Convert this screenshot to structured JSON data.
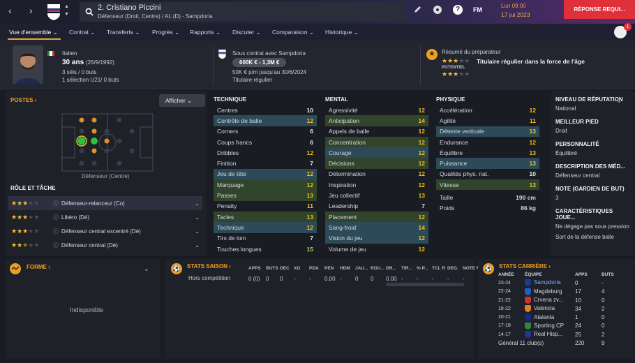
{
  "topbar": {
    "player_name": "2. Cristiano Piccini",
    "subtitle": "Défenseur (Droit, Centre) / AL (D) - Sampdoria",
    "fm_label": "FM",
    "date_line1": "Lun 09:00",
    "date_line2": "17 jui 2023",
    "action_button": "RÉPONSE REQUI...",
    "notification_count": "1"
  },
  "tabs": [
    "Vue d'ensemble",
    "Contrat",
    "Transferts",
    "Progrès",
    "Rapports",
    "Discuter",
    "Comparaison",
    "Historique"
  ],
  "header": {
    "nationality": "Italien",
    "age": "30 ans",
    "birth": "(26/9/1992)",
    "caps": "3 séls / 0 buts",
    "u21": "1 sélection U21/ 0 buts",
    "contract_label": "Sous contrat avec Sampdoria",
    "value_range": "600K € - 1,3M €",
    "wage": "50K € p/m jusqu'au 30/6/2024",
    "status": "Titulaire régulier",
    "coach_label": "Résumé du préparateur",
    "coach_summary": "Titulaire régulier dans la force de l'âge",
    "potential_label": "POTENTIEL"
  },
  "positions": {
    "title": "POSTES",
    "show_button": "Afficher",
    "position_label": "Défenseur (Centre)"
  },
  "roles": {
    "title": "RÔLE ET TÂCHE",
    "items": [
      {
        "label": "Défenseur-relanceur (Co)",
        "stars": 3
      },
      {
        "label": "Libéro (Dé)",
        "stars": 3
      },
      {
        "label": "Défenseur central excentré (Dé)",
        "stars": 3
      },
      {
        "label": "Défenseur central (Dé)",
        "stars": 2.5
      }
    ]
  },
  "technique": {
    "title": "TECHNIQUE",
    "rows": [
      {
        "name": "Centres",
        "value": "10",
        "hl": ""
      },
      {
        "name": "Contrôle de balle",
        "value": "12",
        "hl": "b"
      },
      {
        "name": "Corners",
        "value": "6",
        "hl": ""
      },
      {
        "name": "Coups francs",
        "value": "6",
        "hl": ""
      },
      {
        "name": "Dribbles",
        "value": "12",
        "hl": ""
      },
      {
        "name": "Finition",
        "value": "7",
        "hl": ""
      },
      {
        "name": "Jeu de tête",
        "value": "12",
        "hl": "b"
      },
      {
        "name": "Marquage",
        "value": "12",
        "hl": "g"
      },
      {
        "name": "Passes",
        "value": "13",
        "hl": "g"
      },
      {
        "name": "Penalty",
        "value": "11",
        "hl": ""
      },
      {
        "name": "Tacles",
        "value": "13",
        "hl": "g"
      },
      {
        "name": "Technique",
        "value": "12",
        "hl": "b"
      },
      {
        "name": "Tirs de loin",
        "value": "7",
        "hl": ""
      },
      {
        "name": "Touches longues",
        "value": "15",
        "hl": ""
      }
    ]
  },
  "mental": {
    "title": "MENTAL",
    "rows": [
      {
        "name": "Agressivité",
        "value": "12",
        "hl": ""
      },
      {
        "name": "Anticipation",
        "value": "14",
        "hl": "g"
      },
      {
        "name": "Appels de balle",
        "value": "12",
        "hl": ""
      },
      {
        "name": "Concentration",
        "value": "12",
        "hl": "g"
      },
      {
        "name": "Courage",
        "value": "12",
        "hl": "b"
      },
      {
        "name": "Décisions",
        "value": "12",
        "hl": "g"
      },
      {
        "name": "Détermination",
        "value": "12",
        "hl": ""
      },
      {
        "name": "Inspiration",
        "value": "12",
        "hl": ""
      },
      {
        "name": "Jeu collectif",
        "value": "13",
        "hl": ""
      },
      {
        "name": "Leadership",
        "value": "7",
        "hl": ""
      },
      {
        "name": "Placement",
        "value": "12",
        "hl": "g"
      },
      {
        "name": "Sang-froid",
        "value": "14",
        "hl": "b"
      },
      {
        "name": "Vision du jeu",
        "value": "12",
        "hl": "b"
      },
      {
        "name": "Volume de jeu",
        "value": "12",
        "hl": ""
      }
    ]
  },
  "physique": {
    "title": "PHYSIQUE",
    "rows": [
      {
        "name": "Accélération",
        "value": "12",
        "hl": ""
      },
      {
        "name": "Agilité",
        "value": "11",
        "hl": ""
      },
      {
        "name": "Détente verticale",
        "value": "13",
        "hl": "b"
      },
      {
        "name": "Endurance",
        "value": "12",
        "hl": ""
      },
      {
        "name": "Équilibre",
        "value": "13",
        "hl": ""
      },
      {
        "name": "Puissance",
        "value": "13",
        "hl": "b"
      },
      {
        "name": "Qualités phys. nat.",
        "value": "10",
        "hl": ""
      },
      {
        "name": "Vitesse",
        "value": "13",
        "hl": "g"
      }
    ],
    "height_label": "Taille",
    "height": "190 cm",
    "weight_label": "Poids",
    "weight": "86 kg"
  },
  "right_panel": [
    {
      "title": "NIVEAU DE RÉPUTATION",
      "value": "National"
    },
    {
      "title": "MEILLEUR PIED",
      "value": "Droit"
    },
    {
      "title": "PERSONNALITÉ",
      "value": "Équilibré"
    },
    {
      "title": "DESCRIPTION DES MÉD...",
      "value": "Défenseur central"
    },
    {
      "title": "NOTE (GARDIEN DE BUT)",
      "value": "3"
    },
    {
      "title": "CARACTÉRISTIQUES JOUE...",
      "value": "Ne dégage pas sous pression"
    },
    {
      "title": "",
      "value": "Sort de la défense balle"
    }
  ],
  "form": {
    "title": "FORME",
    "status": "Indisponible"
  },
  "season": {
    "title": "STATS SAISON",
    "columns": [
      "APPS",
      "BUTS",
      "DÉC",
      "XG",
      "PDA",
      "PEN",
      "HDM",
      "JAU...",
      "ROU...",
      "DR...",
      "TIR...",
      "% P...",
      "TCL R",
      "DÉG.",
      "NOTE M..."
    ],
    "row_label": "Hors compétition",
    "row": [
      "0 (0)",
      "0",
      "0",
      "-",
      "-",
      "0.00",
      "-",
      "0",
      "0",
      "0.00",
      "-",
      "-",
      "-",
      "-",
      "-"
    ]
  },
  "career": {
    "title": "STATS CARRIÈRE",
    "headers": {
      "year": "ANNÉE",
      "team": "ÉQUIPE",
      "apps": "APPS",
      "goals": "BUTS"
    },
    "rows": [
      {
        "year": "23-24",
        "team": "Sampdoria",
        "apps": "0",
        "goals": "-"
      },
      {
        "year": "22-24",
        "team": "Magdeburg",
        "apps": "17",
        "goals": "4"
      },
      {
        "year": "21-22",
        "team": "Crvena zv...",
        "apps": "10",
        "goals": "0"
      },
      {
        "year": "18-22",
        "team": "Valencia",
        "apps": "34",
        "goals": "2"
      },
      {
        "year": "20-21",
        "team": "Atalanta",
        "apps": "1",
        "goals": "0"
      },
      {
        "year": "17-18",
        "team": "Sporting CP",
        "apps": "24",
        "goals": "0"
      },
      {
        "year": "14-17",
        "team": "Real Hisp...",
        "apps": "25",
        "goals": "2"
      }
    ],
    "total_label": "Général 11 club(s)",
    "total_apps": "220",
    "total_goals": "9"
  },
  "colors": {
    "accent": "#f0a020",
    "highlight_blue": "#2d4a58",
    "highlight_green": "#31452d",
    "red_button": "#e0303a"
  }
}
